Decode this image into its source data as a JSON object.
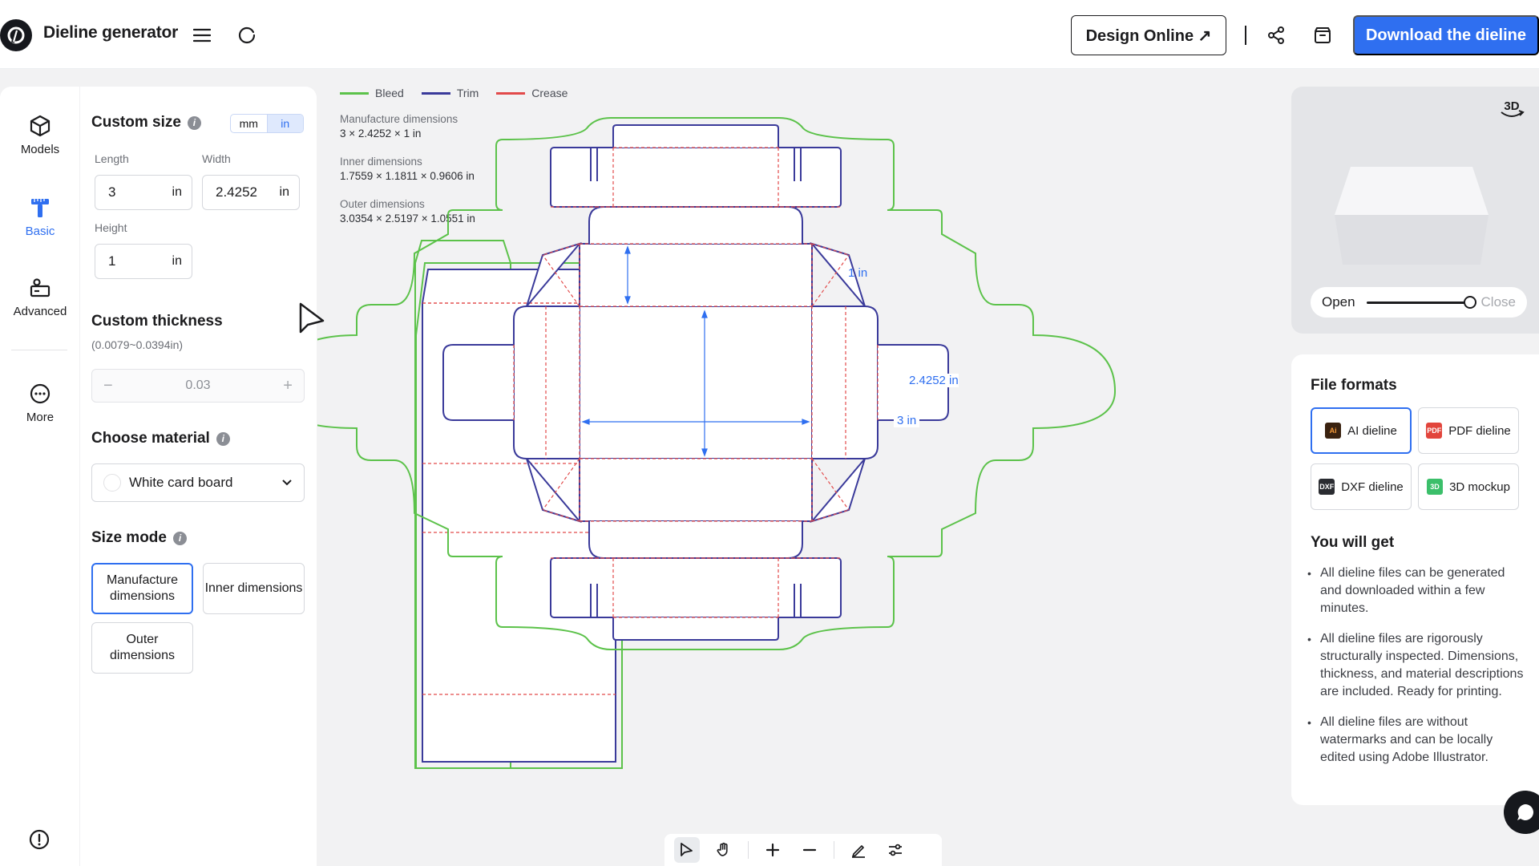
{
  "header": {
    "app_title": "Dieline generator",
    "design_online_label": "Design Online ↗",
    "download_label": "Download the dieline"
  },
  "nav": {
    "items": [
      {
        "label": "Models",
        "icon": "cube-icon"
      },
      {
        "label": "Basic",
        "icon": "ruler-t-icon"
      },
      {
        "label": "Advanced",
        "icon": "advanced-icon"
      },
      {
        "label": "More",
        "icon": "more-icon"
      }
    ],
    "active": "Basic"
  },
  "panel": {
    "custom_size_title": "Custom size",
    "unit_mm": "mm",
    "unit_in": "in",
    "length_label": "Length",
    "length_value": "3",
    "width_label": "Width",
    "width_value": "2.4252",
    "height_label": "Height",
    "height_value": "1",
    "unit": "in",
    "thickness_title": "Custom thickness",
    "thickness_range": "(0.0079~0.0394in)",
    "thickness_value": "0.03",
    "material_title": "Choose material",
    "material_value": "White card board",
    "size_mode_title": "Size mode",
    "size_modes": [
      "Manufacture dimensions",
      "Inner dimensions",
      "Outer dimensions"
    ],
    "size_mode_selected": "Manufacture dimensions"
  },
  "canvas": {
    "legend": [
      {
        "label": "Bleed",
        "color": "#5cc24a"
      },
      {
        "label": "Trim",
        "color": "#3a3a9a"
      },
      {
        "label": "Crease",
        "color": "#e24a4a"
      }
    ],
    "manufacture_label": "Manufacture dimensions",
    "manufacture_value": "3 × 2.4252 × 1 in",
    "inner_label": "Inner dimensions",
    "inner_value": "1.7559 × 1.1811 × 0.9606 in",
    "outer_label": "Outer dimensions",
    "outer_value": "3.0354 × 2.5197 × 1.0551 in",
    "dim_height": "1 in",
    "dim_width": "2.4252 in",
    "dim_length": "3 in"
  },
  "preview": {
    "btn_3d": "3D",
    "open_label": "Open",
    "close_label": "Close"
  },
  "formats": {
    "title": "File formats",
    "items": [
      {
        "label": "AI dieline",
        "icon_text": "Ai",
        "color": "#e06f1f"
      },
      {
        "label": "PDF dieline",
        "icon_text": "PDF",
        "color": "#e2453c"
      },
      {
        "label": "DXF dieline",
        "icon_text": "DXF",
        "color": "#2a2c31"
      },
      {
        "label": "3D mockup",
        "icon_text": "3D",
        "color": "#3bbf6a"
      }
    ],
    "selected": "AI dieline",
    "get_title": "You will get",
    "benefits": [
      "All dieline files can be generated and downloaded within a few minutes.",
      "All dieline files are rigorously structurally inspected. Dimensions, thickness, and material descriptions are included. Ready for printing.",
      "All dieline files are without watermarks and can be locally edited using Adobe Illustrator."
    ]
  }
}
